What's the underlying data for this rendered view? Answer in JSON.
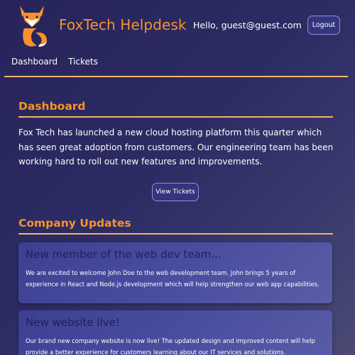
{
  "app": {
    "brand": "FoxTech Helpdesk",
    "greeting": "Hello, guest@guest.com",
    "logout_label": "Logout",
    "colors": {
      "accent": "#f7922c",
      "rule": "#f2b56b",
      "button_bg": "#34357c",
      "button_border": "#8b8fe0",
      "card_title": "#1f2258"
    }
  },
  "nav": {
    "items": [
      {
        "label": "Dashboard"
      },
      {
        "label": "Tickets"
      }
    ]
  },
  "dashboard": {
    "title": "Dashboard",
    "intro": "Fox Tech has launched a new cloud hosting platform this quarter which has seen great adoption from customers. Our engineering team has been working hard to roll out new features and improvements.",
    "view_tickets_label": "View Tickets"
  },
  "updates": {
    "title": "Company Updates",
    "items": [
      {
        "title": "New member of the web dev team...",
        "body": "We are excited to welcome John Doe to the web development team. John brings 5 years of experience in React and Node.js development which will help strengthen our web app capabilities."
      },
      {
        "title": "New website live!",
        "body": "Our brand new company website is now live! The updated design and improved content will help provide a better experience for customers learning about our IT services and solutions."
      }
    ]
  }
}
